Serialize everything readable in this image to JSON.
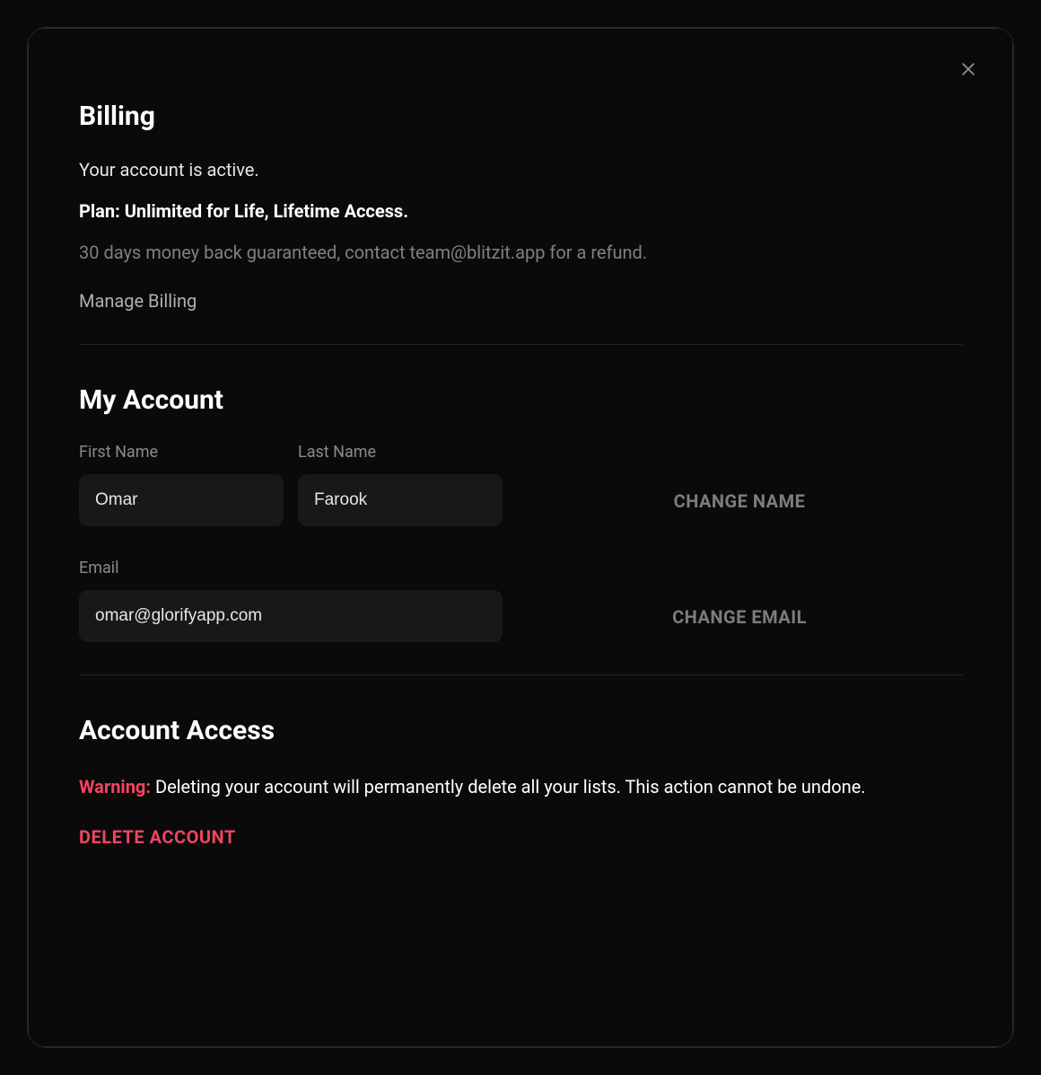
{
  "billing": {
    "title": "Billing",
    "status": "Your account is active.",
    "plan": "Plan: Unlimited for Life, Lifetime Access.",
    "refund_note": "30 days money back guaranteed, contact team@blitzit.app for a refund.",
    "manage_link": "Manage Billing"
  },
  "account": {
    "title": "My Account",
    "first_name_label": "First Name",
    "first_name_value": "Omar",
    "last_name_label": "Last Name",
    "last_name_value": "Farook",
    "change_name_label": "CHANGE NAME",
    "email_label": "Email",
    "email_value": "omar@glorifyapp.com",
    "change_email_label": "CHANGE EMAIL"
  },
  "access": {
    "title": "Account Access",
    "warning_prefix": "Warning:",
    "warning_body": " Deleting your account will permanently delete all your lists. This action cannot be undone.",
    "delete_label": "DELETE ACCOUNT"
  }
}
